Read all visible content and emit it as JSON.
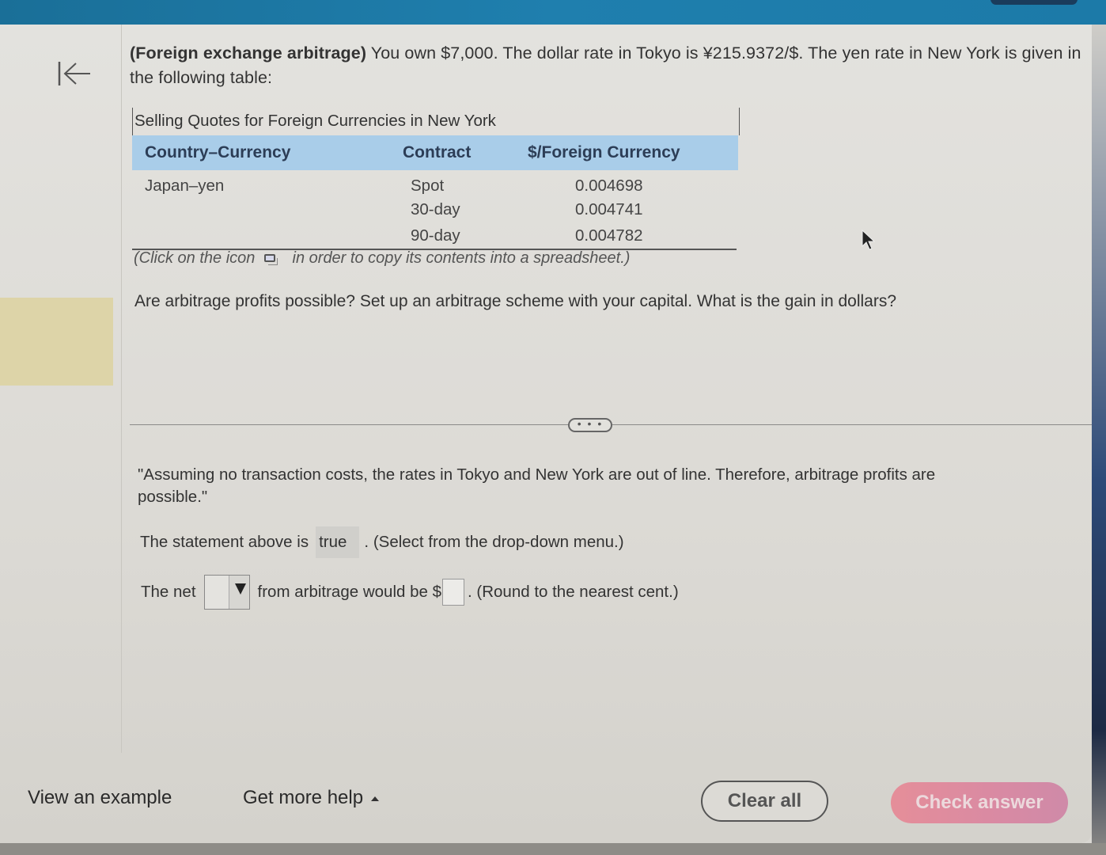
{
  "header": {
    "back_icon": "collapse-left-arrow-icon"
  },
  "problem": {
    "title": "(Foreign exchange arbitrage)",
    "intro_text": " You own $7,000.  The dollar rate in Tokyo is ¥215.9372/$.  The yen rate in New York is given in the following table:",
    "table": {
      "caption": "Selling Quotes for Foreign Currencies in New York",
      "columns": [
        "Country–Currency",
        "Contract",
        "$/Foreign Currency"
      ],
      "rows": [
        [
          "Japan–yen",
          "Spot",
          "0.004698"
        ],
        [
          "",
          "30-day",
          "0.004741"
        ],
        [
          "",
          "90-day",
          "0.004782"
        ]
      ]
    },
    "copy_note_before": "(Click on the icon",
    "copy_note_after": "in order to copy its contents into a spreadsheet.)",
    "copy_icon": "copy-to-spreadsheet-icon",
    "question": "Are arbitrage profits possible?  Set up an arbitrage scheme with your capital.  What is the gain in dollars?"
  },
  "expand_button": {
    "label": "• • •"
  },
  "answer": {
    "quote": "\"Assuming no transaction costs, the rates in Tokyo and New York are out of line.  Therefore, arbitrage profits are possible.\"",
    "statement_before": "The statement above is",
    "statement_selected": "true",
    "statement_after": ".  (Select from the drop-down menu.)",
    "net_before": "The net",
    "net_selected": "",
    "net_middle": "from arbitrage would be $",
    "net_amount": "",
    "net_after": ".  (Round to the nearest cent.)"
  },
  "footer": {
    "view_example": "View an example",
    "get_more_help": "Get more help",
    "clear_all": "Clear all",
    "check_answer": "Check answer"
  },
  "colors": {
    "header_bar": "#1f7fae",
    "table_header": "#a9cde9",
    "check_answer_button": "#e08c9e",
    "highlight_strip": "#ddd4a8"
  }
}
